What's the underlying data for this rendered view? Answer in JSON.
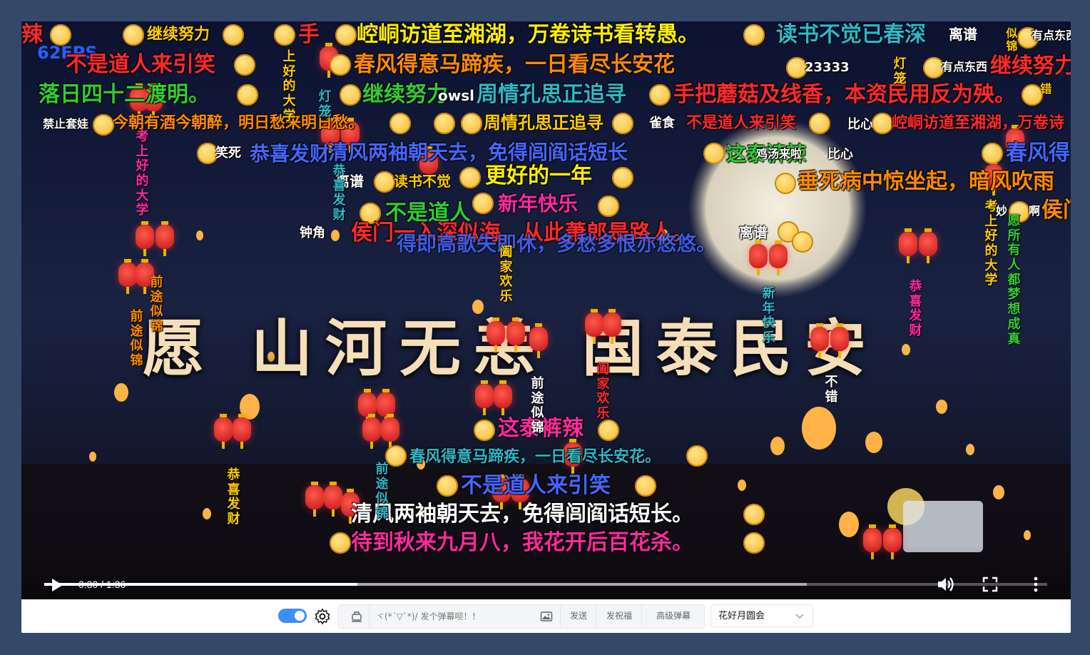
{
  "player": {
    "fps": "62FPS",
    "video_title_text": "愿 山河无恙 国泰民安",
    "time": "0:30 / 1:36",
    "progress": {
      "played": 0.3125,
      "buffered": 0.76
    },
    "icons": [
      "play-icon",
      "volume-icon",
      "fullscreen-icon",
      "more-icon"
    ]
  },
  "danmaku_horizontal": [
    {
      "text": "辣",
      "color": "#ff2a2a"
    },
    {
      "text": "继续努力",
      "color": "#ffcc00"
    },
    {
      "text": "手",
      "color": "#ff2a2a"
    },
    {
      "text": "崆峒访道至湘湖，万卷诗书看转愚。",
      "color": "#ffee00"
    },
    {
      "text": "读书不觉已春深",
      "color": "#2db8c8"
    },
    {
      "text": "离谱",
      "color": "#ffffff"
    },
    {
      "text": "有点东西",
      "color": "#ffffff"
    },
    {
      "text": "不是道人来引笑",
      "color": "#ff2a2a"
    },
    {
      "text": "春风得意马蹄疾，一日看尽长安花",
      "color": "#ff8a00"
    },
    {
      "text": "23333",
      "color": "#ffffff"
    },
    {
      "text": "有点东西",
      "color": "#ffffff"
    },
    {
      "text": "继续努力",
      "color": "#ff2a2a"
    },
    {
      "text": "落日四十二渡明。",
      "color": "#33cc33"
    },
    {
      "text": "继续努力",
      "color": "#33cc33"
    },
    {
      "text": "owsl",
      "color": "#ffffff"
    },
    {
      "text": "周情孔思正追寻",
      "color": "#2db8c8"
    },
    {
      "text": "手把蘑菇及线香，本资民用反为殃。",
      "color": "#ff2a2a"
    },
    {
      "text": "禁止套娃",
      "color": "#ffffff"
    },
    {
      "text": "今朝有酒今朝醉，明日愁来明日愁。",
      "color": "#ff8a00"
    },
    {
      "text": "周情孔思正追寻",
      "color": "#ffcc00"
    },
    {
      "text": "雀食",
      "color": "#ffffff"
    },
    {
      "text": "不是道人来引笑",
      "color": "#ff2a2a"
    },
    {
      "text": "比心",
      "color": "#ffffff"
    },
    {
      "text": "崆峒访道至湘湖，万卷诗",
      "color": "#ff2a2a"
    },
    {
      "text": "笑死",
      "color": "#ffffff"
    },
    {
      "text": "恭喜发财",
      "color": "#4466ff"
    },
    {
      "text": "清风两袖朝天去，免得闾阎话短长",
      "color": "#4466ff"
    },
    {
      "text": "这泰裤辣",
      "color": "#33cc33"
    },
    {
      "text": "鸡汤来啦",
      "color": "#ffffff"
    },
    {
      "text": "比心",
      "color": "#ffffff"
    },
    {
      "text": "春风得",
      "color": "#4466ff"
    },
    {
      "text": "离谱",
      "color": "#ffffff"
    },
    {
      "text": "读书不觉",
      "color": "#ffcc00"
    },
    {
      "text": "更好的一年",
      "color": "#ffee00"
    },
    {
      "text": "垂死病中惊坐起，暗风吹雨",
      "color": "#ff8a00"
    },
    {
      "text": "新年快乐",
      "color": "#ff2aa0"
    },
    {
      "text": "不是道人",
      "color": "#33cc33"
    },
    {
      "text": "妙",
      "color": "#ffffff"
    },
    {
      "text": "啊",
      "color": "#ffffff"
    },
    {
      "text": "侯门",
      "color": "#ff8a00"
    },
    {
      "text": "钟角",
      "color": "#ffffff"
    },
    {
      "text": "侯门一入深似海，从此萧郎是路人。",
      "color": "#ff2a2a"
    },
    {
      "text": "离谱",
      "color": "#ffffff"
    },
    {
      "text": "得即高歌失即休，多愁多恨亦悠悠。",
      "color": "#4466ff"
    },
    {
      "text": "这泰裤辣",
      "color": "#ff2aa0"
    },
    {
      "text": "春风得意马蹄疾，一日看尽长安花。",
      "color": "#2db8c8"
    },
    {
      "text": "不是道人来引笑",
      "color": "#4466ff"
    },
    {
      "text": "清风两袖朝天去，免得闾阎话短长。",
      "color": "#ffffff"
    },
    {
      "text": "待到秋来九月八，我花开后百花杀。",
      "color": "#ff2aa0"
    }
  ],
  "danmaku_vertical": [
    {
      "text": "上好的大学",
      "color": "#ffcc00"
    },
    {
      "text": "灯笼",
      "color": "#2db8c8"
    },
    {
      "text": "考上好的大学",
      "color": "#ff2aa0"
    },
    {
      "text": "前途似锦",
      "color": "#ff8a00"
    },
    {
      "text": "前途似锦",
      "color": "#ff8a00"
    },
    {
      "text": "阖家欢乐",
      "color": "#ffcc00"
    },
    {
      "text": "恭喜发财",
      "color": "#2db8c8"
    },
    {
      "text": "前途似锦",
      "color": "#ffffff"
    },
    {
      "text": "阖家欢乐",
      "color": "#ff2a2a"
    },
    {
      "text": "新年快乐",
      "color": "#2db8c8"
    },
    {
      "text": "恭喜发财",
      "color": "#ff2aa0"
    },
    {
      "text": "不错",
      "color": "#ffffff"
    },
    {
      "text": "恭喜发财",
      "color": "#ffcc00"
    },
    {
      "text": "前途似锦",
      "color": "#2db8c8"
    },
    {
      "text": "考上好的大学",
      "color": "#ffcc00"
    },
    {
      "text": "愿所有人都梦想成真",
      "color": "#33cc33"
    },
    {
      "text": "灯笼",
      "color": "#ffcc00"
    },
    {
      "text": "似锦",
      "color": "#ffcc00"
    },
    {
      "text": "错",
      "color": "#ffcc00"
    }
  ],
  "bottom_bar": {
    "danmaku_toggle_on": true,
    "input_placeholder": "ヾ(*´▽`*)/ 发个弹幕呗！！",
    "send_label": "发送",
    "blessing_label": "发祝福",
    "advanced_label": "高级弹幕",
    "select_value": "花好月圆会"
  }
}
